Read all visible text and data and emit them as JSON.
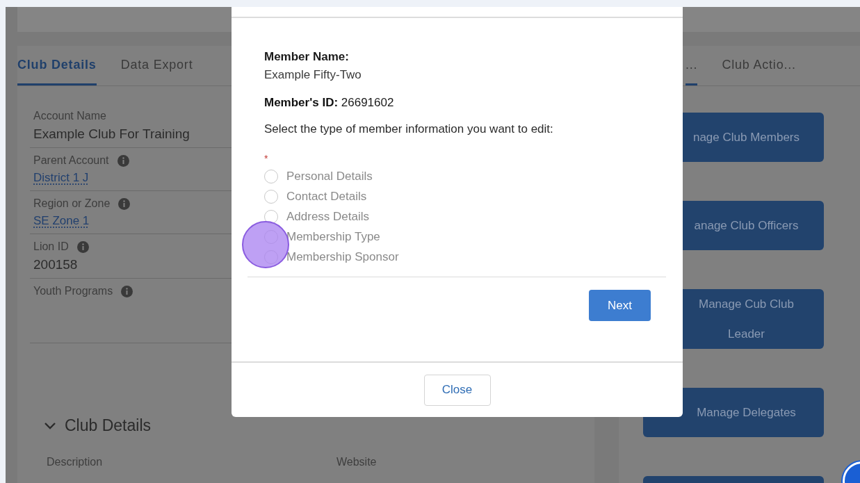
{
  "background": {
    "tabs_left": [
      {
        "label": "Club Details",
        "selected": true
      },
      {
        "label": "Data Export",
        "selected": false
      }
    ],
    "fields": [
      {
        "label": "Account Name",
        "info": false,
        "value": "Example Club For Training",
        "kind": "text"
      },
      {
        "label": "Parent Account",
        "info": true,
        "value": "District 1 J",
        "kind": "link"
      },
      {
        "label": "Region or Zone",
        "info": true,
        "value": "SE Zone 1",
        "kind": "link"
      },
      {
        "label": "Lion ID",
        "info": true,
        "value": "200158",
        "kind": "text"
      },
      {
        "label": "Youth Programs",
        "info": true,
        "kind": "empty"
      }
    ],
    "section": {
      "title": "Club Details",
      "expanded": true
    },
    "section_fields": [
      "Description",
      "Website"
    ],
    "tabs_right": [
      {
        "label": "...",
        "selected": true
      },
      {
        "label": "Club Actio...",
        "selected": false
      }
    ],
    "actions": [
      "nage Club Members",
      "anage Club Officers",
      "Manage Cub Club Leader",
      "Manage Delegates"
    ]
  },
  "modal": {
    "member_name_label": "Member Name:",
    "member_name": "Example Fifty-Two",
    "member_id": "**Member's ID:** 26691602",
    "prompt": "Select the type of member information you want to edit:",
    "required_mark": "*",
    "options": [
      {
        "label": "Personal Details",
        "selected": false
      },
      {
        "label": "Contact Details",
        "selected": false
      },
      {
        "label": "Address Details",
        "selected": false
      },
      {
        "label": "Membership Type",
        "selected": false
      },
      {
        "label": "Membership Sponsor",
        "selected": false
      }
    ],
    "next": "Next",
    "close": "Close"
  }
}
